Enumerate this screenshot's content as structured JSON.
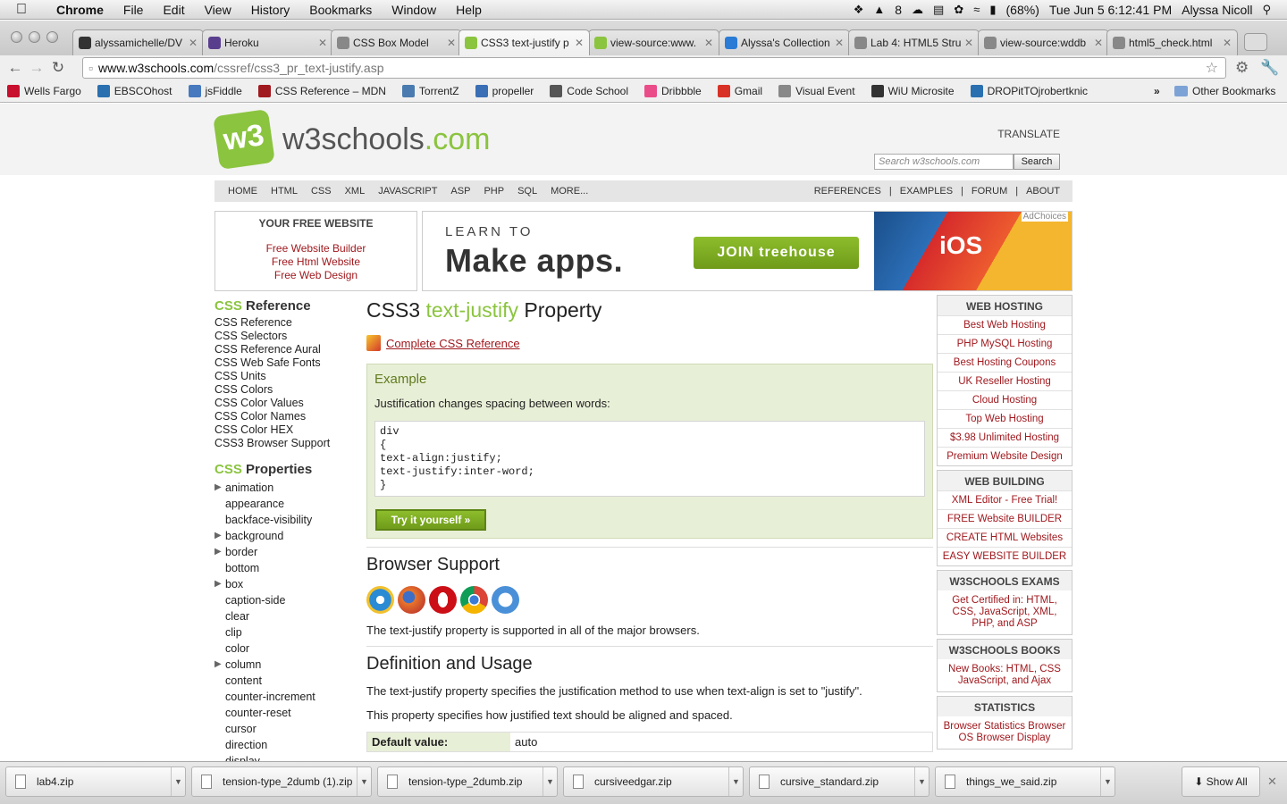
{
  "menubar": {
    "app": "Chrome",
    "items": [
      "File",
      "Edit",
      "View",
      "History",
      "Bookmarks",
      "Window",
      "Help"
    ],
    "status": {
      "adobe_count": "8",
      "battery": "(68%)",
      "datetime": "Tue Jun 5  6:12:41 PM",
      "user": "Alyssa Nicoll"
    }
  },
  "tabs": [
    {
      "label": "alyssamichelle/DV",
      "color": "#333333"
    },
    {
      "label": "Heroku",
      "color": "#5a3e8e"
    },
    {
      "label": "CSS Box Model",
      "color": "#888888"
    },
    {
      "label": "CSS3 text-justify p",
      "color": "#8bc43f"
    },
    {
      "label": "view-source:www.",
      "color": "#8bc43f"
    },
    {
      "label": "Alyssa's Collection",
      "color": "#2a7bd6"
    },
    {
      "label": "Lab 4: HTML5 Stru",
      "color": "#888888"
    },
    {
      "label": "view-source:wddb",
      "color": "#888888"
    },
    {
      "label": "html5_check.html",
      "color": "#888888"
    }
  ],
  "address": {
    "host": "www.w3schools.com",
    "path": "/cssref/css3_pr_text-justify.asp"
  },
  "bookmarks": [
    {
      "label": "Wells Fargo",
      "color": "#c8102e"
    },
    {
      "label": "EBSCOhost",
      "color": "#2a6fb0"
    },
    {
      "label": "jsFiddle",
      "color": "#4679bd"
    },
    {
      "label": "CSS Reference – MDN",
      "color": "#a0191e"
    },
    {
      "label": "TorrentZ",
      "color": "#4a7bb0"
    },
    {
      "label": "propeller",
      "color": "#3a6eb5"
    },
    {
      "label": "Code School",
      "color": "#555555"
    },
    {
      "label": "Dribbble",
      "color": "#ea4c89"
    },
    {
      "label": "Gmail",
      "color": "#d93025"
    },
    {
      "label": "Visual Event",
      "color": "#888888"
    },
    {
      "label": "WiU Microsite",
      "color": "#333333"
    },
    {
      "label": "DROPitTOjrobertknic",
      "color": "#2a6fb0"
    }
  ],
  "other_bookmarks": "Other Bookmarks",
  "site": {
    "logo_text": "w3schools",
    "logo_tld": ".com",
    "translate": "TRANSLATE",
    "search_placeholder": "Search w3schools.com",
    "search_button": "Search",
    "nav_left": [
      "HOME",
      "HTML",
      "CSS",
      "XML",
      "JAVASCRIPT",
      "ASP",
      "PHP",
      "SQL",
      "MORE..."
    ],
    "nav_right": [
      "REFERENCES",
      "|",
      "EXAMPLES",
      "|",
      "FORUM",
      "|",
      "ABOUT"
    ]
  },
  "free_site": {
    "heading": "YOUR FREE WEBSITE",
    "links": [
      "Free Website Builder",
      "Free Html Website",
      "Free Web Design"
    ]
  },
  "ad": {
    "learn": "LEARN TO",
    "make": "Make apps.",
    "join": "JOIN treehouse",
    "ios": "iOS",
    "adchoices": "AdChoices"
  },
  "leftnav": {
    "ref_title_kw": "CSS",
    "ref_title": " Reference",
    "ref_items": [
      "CSS Reference",
      "CSS Selectors",
      "CSS Reference Aural",
      "CSS Web Safe Fonts",
      "CSS Units",
      "CSS Colors",
      "CSS Color Values",
      "CSS Color Names",
      "CSS Color HEX",
      "CSS3 Browser Support"
    ],
    "props_title_kw": "CSS",
    "props_title": " Properties",
    "props": [
      {
        "label": "animation",
        "expandable": true
      },
      {
        "label": "appearance",
        "expandable": false
      },
      {
        "label": "backface-visibility",
        "expandable": false
      },
      {
        "label": "background",
        "expandable": true
      },
      {
        "label": "border",
        "expandable": true
      },
      {
        "label": "bottom",
        "expandable": false
      },
      {
        "label": "box",
        "expandable": true
      },
      {
        "label": "caption-side",
        "expandable": false
      },
      {
        "label": "clear",
        "expandable": false
      },
      {
        "label": "clip",
        "expandable": false
      },
      {
        "label": "color",
        "expandable": false
      },
      {
        "label": "column",
        "expandable": true
      },
      {
        "label": "content",
        "expandable": false
      },
      {
        "label": "counter-increment",
        "expandable": false
      },
      {
        "label": "counter-reset",
        "expandable": false
      },
      {
        "label": "cursor",
        "expandable": false
      },
      {
        "label": "direction",
        "expandable": false
      },
      {
        "label": "display",
        "expandable": false
      }
    ]
  },
  "main": {
    "title_pre": "CSS3 ",
    "title_kw": "text-justify",
    "title_post": " Property",
    "ref_link": "Complete CSS Reference",
    "example_heading": "Example",
    "example_desc": "Justification changes spacing between words:",
    "code": "div\n{\ntext-align:justify;\ntext-justify:inter-word;\n}",
    "try_button": "Try it yourself »",
    "support_heading": "Browser Support",
    "support_text": "The text-justify property is supported in all of the major browsers.",
    "def_heading": "Definition and Usage",
    "def_p1": "The text-justify property specifies the justification method to use when text-align is set to \"justify\".",
    "def_p2": "This property specifies how justified text should be aligned and spaced.",
    "default_key": "Default value:",
    "default_val": "auto"
  },
  "rightcol": [
    {
      "heading": "WEB HOSTING",
      "items": [
        "Best Web Hosting",
        "PHP MySQL Hosting",
        "Best Hosting Coupons",
        "UK Reseller Hosting",
        "Cloud Hosting",
        "Top Web Hosting",
        "$3.98 Unlimited Hosting",
        "Premium Website Design"
      ]
    },
    {
      "heading": "WEB BUILDING",
      "items": [
        "XML Editor - Free Trial!",
        "FREE Website BUILDER",
        "CREATE HTML Websites",
        "EASY WEBSITE BUILDER"
      ]
    },
    {
      "heading": "W3SCHOOLS EXAMS",
      "text": "Get Certified in: HTML, CSS, JavaScript, XML, PHP, and ASP"
    },
    {
      "heading": "W3SCHOOLS BOOKS",
      "text": "New Books: HTML, CSS JavaScript, and Ajax"
    },
    {
      "heading": "STATISTICS",
      "text": "Browser Statistics Browser OS Browser Display"
    }
  ],
  "downloads": [
    "lab4.zip",
    "tension-type_2dumb (1).zip",
    "tension-type_2dumb.zip",
    "cursiveedgar.zip",
    "cursive_standard.zip",
    "things_we_said.zip"
  ],
  "show_all": "Show All"
}
